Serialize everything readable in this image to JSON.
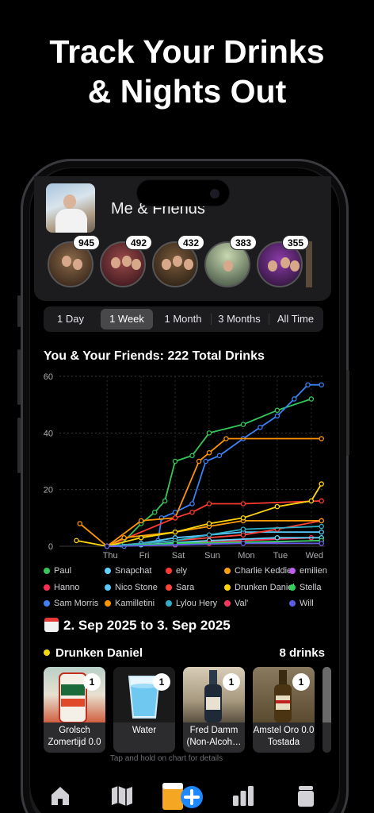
{
  "headline": {
    "line1": "Track Your Drinks",
    "line2": "& Nights Out"
  },
  "profile": {
    "title": "Me & Friends"
  },
  "friends": [
    {
      "badge": "945"
    },
    {
      "badge": "492"
    },
    {
      "badge": "432"
    },
    {
      "badge": "383"
    },
    {
      "badge": "355"
    }
  ],
  "ranges": {
    "options": [
      "1 Day",
      "1 Week",
      "1 Month",
      "3 Months",
      "All Time"
    ],
    "selected": "1 Week"
  },
  "chart_data": {
    "type": "line",
    "title": "You & Your Friends: 222 Total Drinks",
    "x_ticks": [
      "Thu",
      "Fri",
      "Sat",
      "Sun",
      "Mon",
      "Tue",
      "Wed"
    ],
    "ylim": [
      0,
      60
    ],
    "y_ticks": [
      0,
      20,
      40,
      60
    ],
    "grid": true,
    "legend_position": "bottom",
    "series": [
      {
        "name": "Paul",
        "color": "#34c759",
        "values": [
          [
            0,
            0
          ],
          [
            0.4,
            0.5
          ],
          [
            1,
            8
          ],
          [
            1.4,
            12
          ],
          [
            1.7,
            16
          ],
          [
            2,
            30
          ],
          [
            2.5,
            32
          ],
          [
            3,
            40
          ],
          [
            4,
            43
          ],
          [
            5,
            48
          ],
          [
            6,
            52
          ]
        ]
      },
      {
        "name": "Hanno",
        "color": "#ff2d55",
        "values": [
          [
            0,
            0
          ],
          [
            2,
            1
          ],
          [
            4,
            2
          ],
          [
            6,
            3
          ]
        ]
      },
      {
        "name": "Sam Morris",
        "color": "#3b82f6",
        "values": [
          [
            0,
            0
          ],
          [
            0.5,
            0
          ],
          [
            1,
            1
          ],
          [
            1.5,
            2
          ],
          [
            1.6,
            10
          ],
          [
            2,
            12
          ],
          [
            2.5,
            15
          ],
          [
            2.9,
            30
          ],
          [
            3.3,
            32
          ],
          [
            4,
            38
          ],
          [
            4.5,
            42
          ],
          [
            5,
            46
          ],
          [
            5.5,
            52
          ],
          [
            5.9,
            57
          ],
          [
            6.3,
            57
          ]
        ]
      },
      {
        "name": "Snapchat",
        "color": "#64d2ff",
        "values": [
          [
            0,
            0
          ],
          [
            1,
            0.5
          ],
          [
            3,
            2
          ],
          [
            5,
            3
          ],
          [
            6.3,
            3
          ]
        ]
      },
      {
        "name": "Nico Stone",
        "color": "#5ac8fa",
        "values": [
          [
            0,
            0
          ],
          [
            1,
            1
          ],
          [
            2,
            3
          ],
          [
            4,
            5
          ],
          [
            6.3,
            5
          ]
        ]
      },
      {
        "name": "Kamilletini",
        "color": "#ff9500",
        "values": [
          [
            0,
            0
          ],
          [
            -0.8,
            8
          ],
          [
            1,
            9
          ],
          [
            2,
            10
          ],
          [
            2.7,
            30
          ],
          [
            3,
            33
          ],
          [
            3.5,
            38
          ],
          [
            6.3,
            38
          ]
        ]
      },
      {
        "name": "ely",
        "color": "#ff3b30",
        "values": [
          [
            0,
            0
          ],
          [
            2,
            10
          ],
          [
            2.5,
            12
          ],
          [
            3,
            15
          ],
          [
            4,
            15
          ],
          [
            6.3,
            16
          ]
        ]
      },
      {
        "name": "Sara",
        "color": "#ff453a",
        "values": [
          [
            0,
            0
          ],
          [
            2,
            2
          ],
          [
            4,
            4
          ],
          [
            5,
            6
          ],
          [
            6.3,
            9
          ]
        ]
      },
      {
        "name": "Lylou Hery",
        "color": "#30b0c7",
        "values": [
          [
            0,
            0
          ],
          [
            2,
            2
          ],
          [
            3,
            4
          ],
          [
            4,
            6
          ],
          [
            6.3,
            7
          ]
        ]
      },
      {
        "name": "Charlie Keddie",
        "color": "#ff9f0a",
        "values": [
          [
            0,
            0
          ],
          [
            0.5,
            3
          ],
          [
            2,
            5
          ],
          [
            3,
            7
          ],
          [
            4,
            9
          ],
          [
            6.3,
            9
          ]
        ]
      },
      {
        "name": "Drunken Daniel",
        "color": "#ffd60a",
        "values": [
          [
            0,
            0
          ],
          [
            -0.9,
            2
          ],
          [
            1,
            3
          ],
          [
            2,
            5
          ],
          [
            3,
            8
          ],
          [
            4,
            10
          ],
          [
            5,
            14
          ],
          [
            6,
            16
          ],
          [
            6.3,
            22
          ]
        ]
      },
      {
        "name": "Val'",
        "color": "#ff375f",
        "values": [
          [
            0,
            0
          ],
          [
            3,
            1
          ],
          [
            6.3,
            1
          ]
        ]
      },
      {
        "name": "emilien",
        "color": "#bf5af2",
        "values": [
          [
            0,
            0
          ],
          [
            2,
            0.5
          ],
          [
            6.3,
            2
          ]
        ]
      },
      {
        "name": "Stella",
        "color": "#30d158",
        "values": [
          [
            0,
            0
          ],
          [
            2,
            1
          ],
          [
            6.3,
            2
          ]
        ]
      },
      {
        "name": "Will",
        "color": "#5e5ce6",
        "values": [
          [
            0,
            0
          ],
          [
            4,
            1
          ],
          [
            6.3,
            1
          ]
        ]
      }
    ]
  },
  "legend": [
    {
      "label": "Paul",
      "color": "#34c759"
    },
    {
      "label": "Snapchat",
      "color": "#64d2ff"
    },
    {
      "label": "ely",
      "color": "#ff3b30"
    },
    {
      "label": "Charlie Keddie",
      "color": "#ff9f0a"
    },
    {
      "label": "emilien",
      "color": "#bf5af2"
    },
    {
      "label": "Hanno",
      "color": "#ff2d55"
    },
    {
      "label": "Nico Stone",
      "color": "#5ac8fa"
    },
    {
      "label": "Sara",
      "color": "#ff453a"
    },
    {
      "label": "Drunken Daniel",
      "color": "#ffd60a"
    },
    {
      "label": "Stella",
      "color": "#30d158"
    },
    {
      "label": "Sam Morris",
      "color": "#3b82f6"
    },
    {
      "label": "Kamilletini",
      "color": "#ff9500"
    },
    {
      "label": "Lylou Hery",
      "color": "#30b0c7"
    },
    {
      "label": "Val'",
      "color": "#ff375f"
    },
    {
      "label": "Will",
      "color": "#5e5ce6"
    }
  ],
  "detail": {
    "date_range": "2. Sep 2025 to 3. Sep 2025",
    "person": "Drunken Daniel",
    "drink_count": "8 drinks",
    "hint": "Tap and hold on chart for details"
  },
  "drinks": [
    {
      "name": "Grolsch Zomertijd 0.0",
      "count": "1"
    },
    {
      "name": "Water",
      "count": "1"
    },
    {
      "name": "Fred Damm (Non-Alcoh…",
      "count": "1"
    },
    {
      "name": "Amstel Oro 0.0 Tostada",
      "count": "1"
    }
  ],
  "tabs": [
    {
      "icon": "home-icon"
    },
    {
      "icon": "map-icon"
    },
    {
      "icon": "add-drink-icon"
    },
    {
      "icon": "stats-icon"
    },
    {
      "icon": "glass-icon"
    }
  ]
}
